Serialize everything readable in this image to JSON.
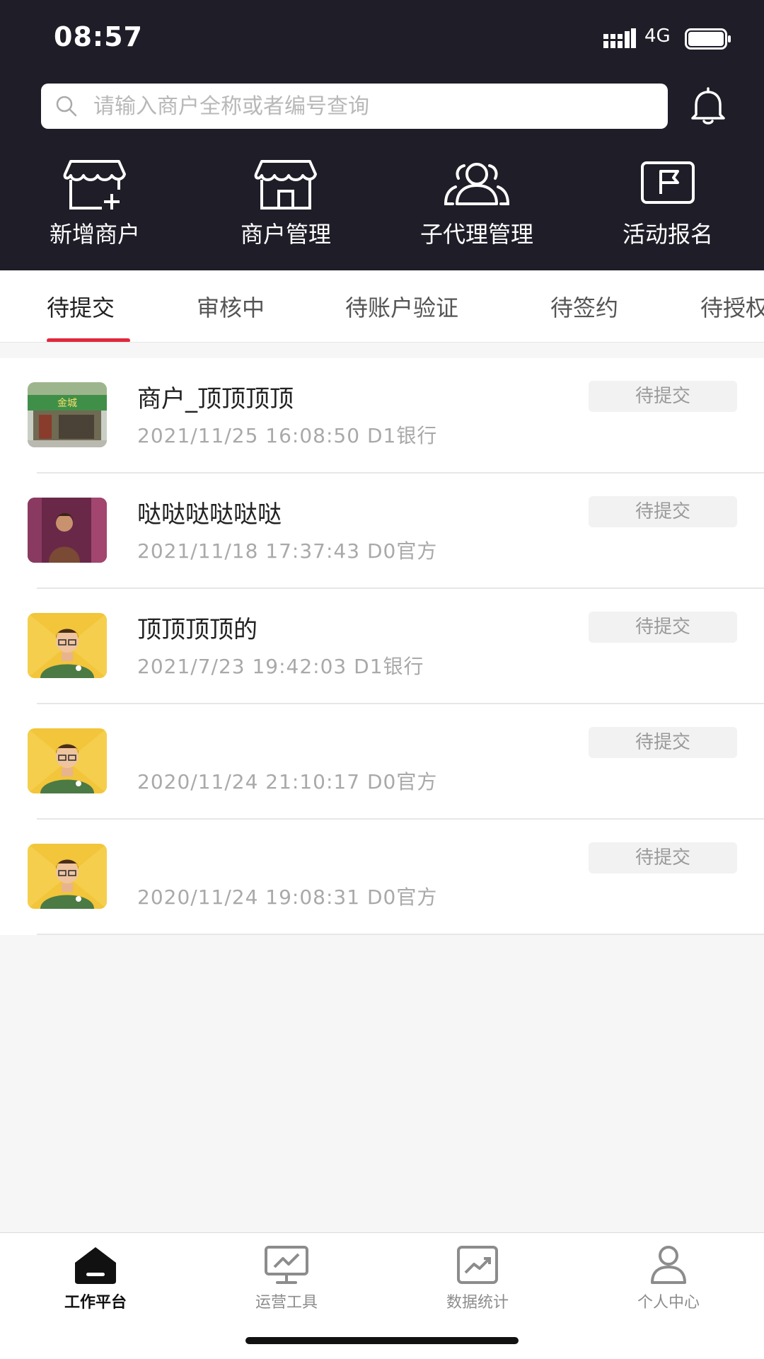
{
  "status_bar": {
    "time": "08:57",
    "network": "4G"
  },
  "search": {
    "placeholder": "请输入商户全称或者编号查询"
  },
  "quick_actions": [
    {
      "label": "新增商户",
      "icon": "store-add-icon"
    },
    {
      "label": "商户管理",
      "icon": "store-icon"
    },
    {
      "label": "子代理管理",
      "icon": "users-icon"
    },
    {
      "label": "活动报名",
      "icon": "flag-icon"
    }
  ],
  "tabs": [
    {
      "label": "待提交",
      "active": true
    },
    {
      "label": "审核中"
    },
    {
      "label": "待账户验证"
    },
    {
      "label": "待签约"
    },
    {
      "label": "待授权"
    }
  ],
  "merchants": [
    {
      "name": "商户_顶顶顶顶",
      "datetime": "2021/11/25 16:08:50",
      "type": "D1银行",
      "status": "待提交",
      "thumb": "storefront-photo"
    },
    {
      "name": "哒哒哒哒哒哒",
      "datetime": "2021/11/18 17:37:43",
      "type": "D0官方",
      "status": "待提交",
      "thumb": "person-photo"
    },
    {
      "name": "顶顶顶顶的",
      "datetime": "2021/7/23 19:42:03",
      "type": "D1银行",
      "status": "待提交",
      "thumb": "cartoon-avatar"
    },
    {
      "name": "",
      "datetime": "2020/11/24 21:10:17",
      "type": "D0官方",
      "status": "待提交",
      "thumb": "cartoon-avatar"
    },
    {
      "name": "",
      "datetime": "2020/11/24 19:08:31",
      "type": "D0官方",
      "status": "待提交",
      "thumb": "cartoon-avatar"
    }
  ],
  "bottom_nav": [
    {
      "label": "工作平台",
      "icon": "home-icon",
      "active": true
    },
    {
      "label": "运营工具",
      "icon": "monitor-icon"
    },
    {
      "label": "数据统计",
      "icon": "chart-icon"
    },
    {
      "label": "个人中心",
      "icon": "person-icon"
    }
  ],
  "colors": {
    "header_bg": "#1e1d28",
    "accent": "#e0283c"
  }
}
